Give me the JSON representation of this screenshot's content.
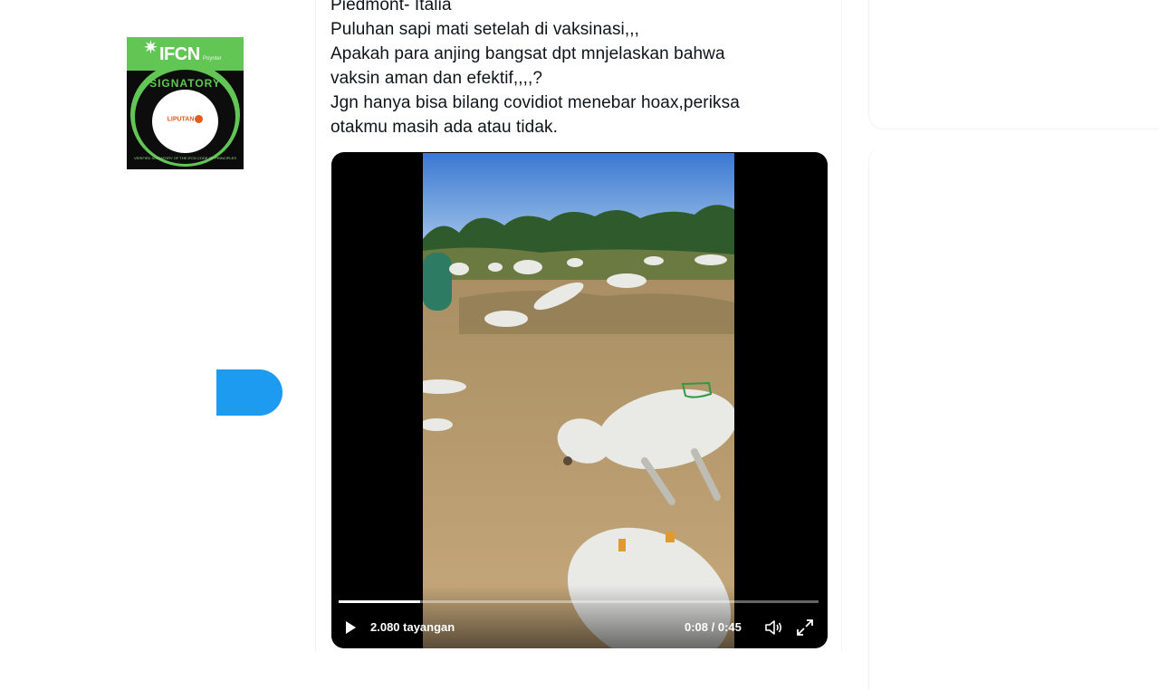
{
  "badge": {
    "brand": "IFCN",
    "brand_sub": "Poynter",
    "ring_text": "SIGNATORY",
    "partner_logo": "LIPUTAN",
    "small_text": "VERIFIED SIGNATORY OF THE IFCN CODE OF PRINCIPLES",
    "colors": {
      "green": "#62c655",
      "black": "#0b0b0b",
      "orange": "#e35b1d"
    }
  },
  "tweet": {
    "lines": [
      "Piedmont- Italia",
      "Puluhan sapi mati setelah di vaksinasi,,,",
      "Apakah para anjing  bangsat dpt mnjelaskan bahwa",
      "vaksin aman dan efektif,,,,?",
      "Jgn hanya bisa bilang covidiot menebar hoax,periksa",
      "otakmu masih ada atau tidak."
    ]
  },
  "video": {
    "views": "2.080 tayangan",
    "time": "0:08 / 0:45",
    "progress": 0.17,
    "icons": {
      "play": "play-icon",
      "volume": "volume-icon",
      "fullscreen": "fullscreen-icon"
    }
  },
  "colors": {
    "accent": "#1d9bf0",
    "text": "#0f1419",
    "border": "#eff3f4"
  }
}
